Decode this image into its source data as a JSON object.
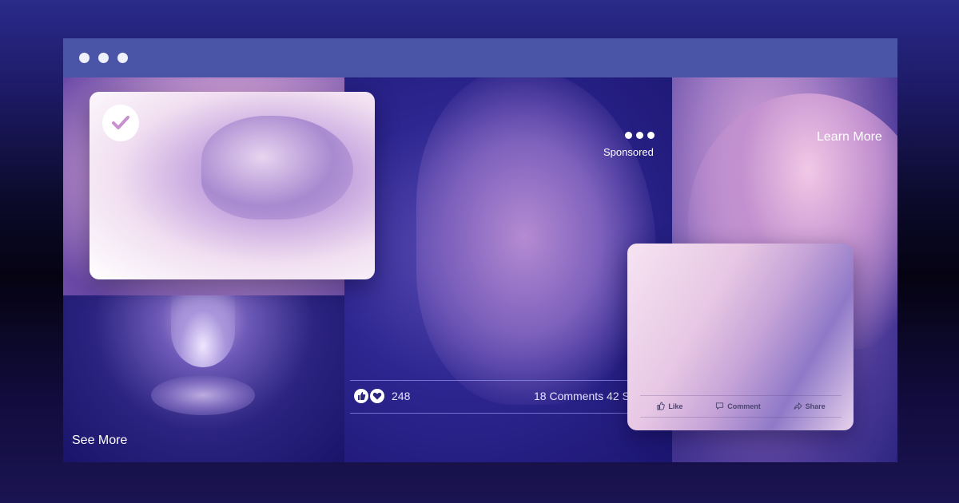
{
  "panels": {
    "bottom_left": {
      "link_label": "See More"
    },
    "center": {
      "sponsored_label": "Sponsored"
    },
    "right": {
      "link_label": "Learn More"
    }
  },
  "reactions": {
    "count": "248",
    "comments_shares": "18 Comments 42 Shares"
  },
  "post_card": {
    "actions": [
      {
        "label": "Like",
        "icon": "thumbs-up-icon"
      },
      {
        "label": "Comment",
        "icon": "comment-icon"
      },
      {
        "label": "Share",
        "icon": "share-icon"
      }
    ]
  },
  "colors": {
    "titlebar": "#4a55a8",
    "accent": "#ffffff"
  }
}
